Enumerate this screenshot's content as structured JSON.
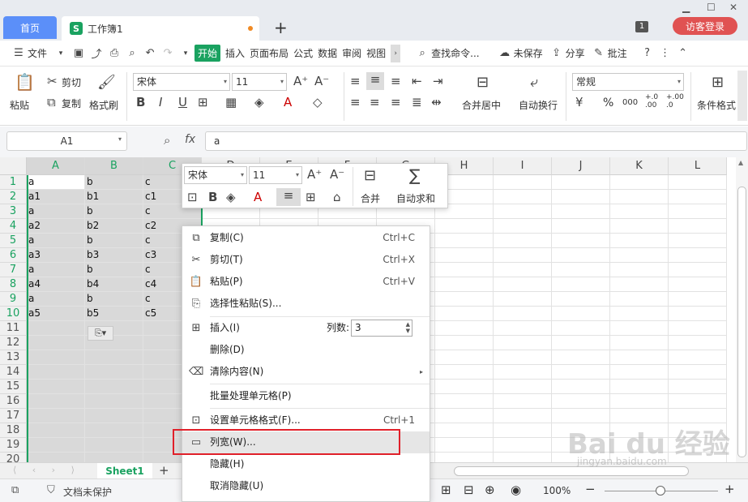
{
  "titlebar": {
    "home_tab": "首页",
    "doc_tab": "工作簿1",
    "doc_logo": "S",
    "new_tab": "+",
    "notif_count": "1",
    "login": "访客登录",
    "minimize": "▁",
    "maximize": "☐",
    "close": "✕"
  },
  "menu": {
    "file": "文件",
    "start": "开始",
    "insert": "插入",
    "page_layout": "页面布局",
    "formula": "公式",
    "data": "数据",
    "review": "审阅",
    "view": "视图",
    "search": "查找命令...",
    "unsaved": "未保存",
    "share": "分享",
    "comment": "批注"
  },
  "ribbon": {
    "paste": "粘贴",
    "cut": "剪切",
    "copy": "复制",
    "format_painter": "格式刷",
    "font_name": "宋体",
    "font_size": "11",
    "merge_center": "合并居中",
    "wrap_text": "自动换行",
    "number_format": "常规",
    "cond_format": "条件格式",
    "percent": "%",
    "thousands": "000",
    "inc_decimal": "+.0\n.00",
    "dec_decimal": "+.00\n.0"
  },
  "formula_bar": {
    "name_box": "A1",
    "fx": "fx",
    "content": "a"
  },
  "grid": {
    "columns": [
      "A",
      "B",
      "C",
      "D",
      "E",
      "F",
      "G",
      "H",
      "I",
      "J",
      "K",
      "L"
    ],
    "rows": [
      "1",
      "2",
      "3",
      "4",
      "5",
      "6",
      "7",
      "8",
      "9",
      "10",
      "11",
      "12",
      "13",
      "14",
      "15",
      "16",
      "17",
      "18",
      "19",
      "20"
    ],
    "data": [
      [
        "a",
        "b",
        "c"
      ],
      [
        "a1",
        "b1",
        "c1"
      ],
      [
        "a",
        "b",
        "c"
      ],
      [
        "a2",
        "b2",
        "c2"
      ],
      [
        "a",
        "b",
        "c"
      ],
      [
        "a3",
        "b3",
        "c3"
      ],
      [
        "a",
        "b",
        "c"
      ],
      [
        "a4",
        "b4",
        "c4"
      ],
      [
        "a",
        "b",
        "c"
      ],
      [
        "a5",
        "b5",
        "c5"
      ]
    ]
  },
  "minibar": {
    "font_name": "宋体",
    "font_size": "11",
    "merge": "合并",
    "autosum": "自动求和"
  },
  "context_menu": {
    "items": [
      {
        "label": "复制(C)",
        "shortcut": "Ctrl+C"
      },
      {
        "label": "剪切(T)",
        "shortcut": "Ctrl+X"
      },
      {
        "label": "粘贴(P)",
        "shortcut": "Ctrl+V"
      },
      {
        "label": "选择性粘贴(S)...",
        "shortcut": ""
      },
      {
        "label": "插入(I)",
        "shortcut": ""
      },
      {
        "label": "删除(D)",
        "shortcut": ""
      },
      {
        "label": "清除内容(N)",
        "shortcut": ""
      },
      {
        "label": "批量处理单元格(P)",
        "shortcut": ""
      },
      {
        "label": "设置单元格格式(F)...",
        "shortcut": "Ctrl+1"
      },
      {
        "label": "列宽(W)...",
        "shortcut": ""
      },
      {
        "label": "隐藏(H)",
        "shortcut": ""
      },
      {
        "label": "取消隐藏(U)",
        "shortcut": ""
      }
    ],
    "col_count_label": "列数:",
    "col_count_value": "3"
  },
  "sheets": {
    "active": "Sheet1",
    "add": "+"
  },
  "status": {
    "protect": "文档未保护",
    "zoom": "100%"
  },
  "watermark": {
    "brand": "Bai du 经验",
    "url": "jingyan.baidu.com"
  }
}
